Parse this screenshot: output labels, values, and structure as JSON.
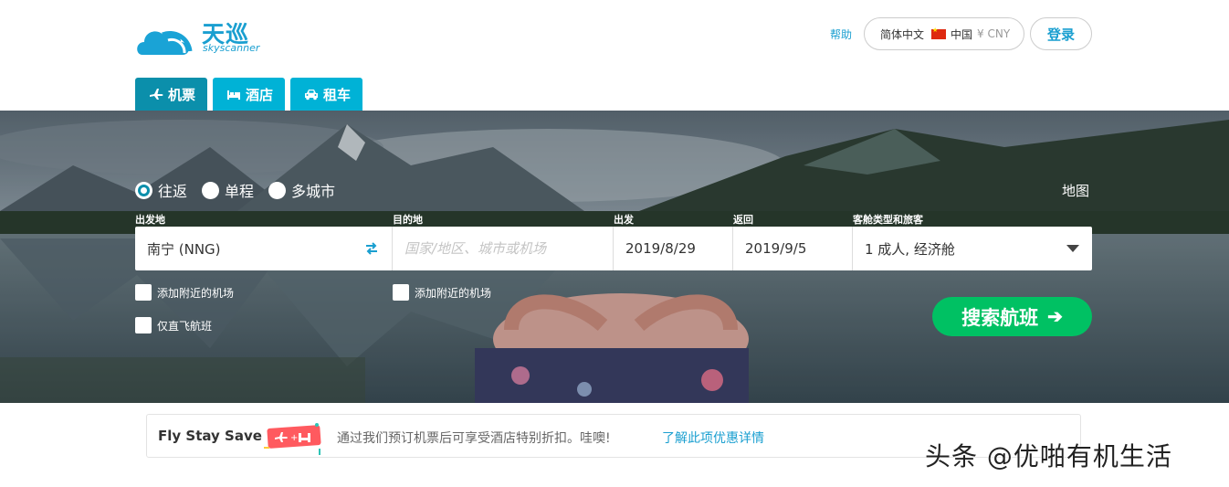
{
  "brand": {
    "name_cn": "天巡",
    "name_en": "skyscanner",
    "color": "#1a9fd0"
  },
  "header": {
    "help": "帮助",
    "locale": {
      "language": "简体中文",
      "country": "中国",
      "currency": "¥ CNY"
    },
    "login": "登录"
  },
  "tabs": [
    {
      "label": "机票",
      "icon": "plane-icon",
      "active": true
    },
    {
      "label": "酒店",
      "icon": "bed-icon",
      "active": false
    },
    {
      "label": "租车",
      "icon": "car-icon",
      "active": false
    }
  ],
  "search": {
    "trip_types": [
      {
        "label": "往返",
        "selected": true
      },
      {
        "label": "单程",
        "selected": false
      },
      {
        "label": "多城市",
        "selected": false
      }
    ],
    "map_link": "地图",
    "labels": {
      "origin": "出发地",
      "destination": "目的地",
      "depart": "出发",
      "return": "返回",
      "cabin": "客舱类型和旅客"
    },
    "origin_value": "南宁 (NNG)",
    "destination_placeholder": "国家/地区、城市或机场",
    "depart_value": "2019/8/29",
    "return_value": "2019/9/5",
    "cabin_value": "1 成人, 经济舱",
    "nearby_origin": "添加附近的机场",
    "nearby_destination": "添加附近的机场",
    "direct_only": "仅直飞航班",
    "search_button": "搜索航班",
    "search_button_color": "#00c163"
  },
  "promo": {
    "title": "Fly Stay Save",
    "text": "通过我们预订机票后可享受酒店特别折扣。哇噢!",
    "link": "了解此项优惠详情"
  },
  "watermark": "头条 @优啪有机生活"
}
